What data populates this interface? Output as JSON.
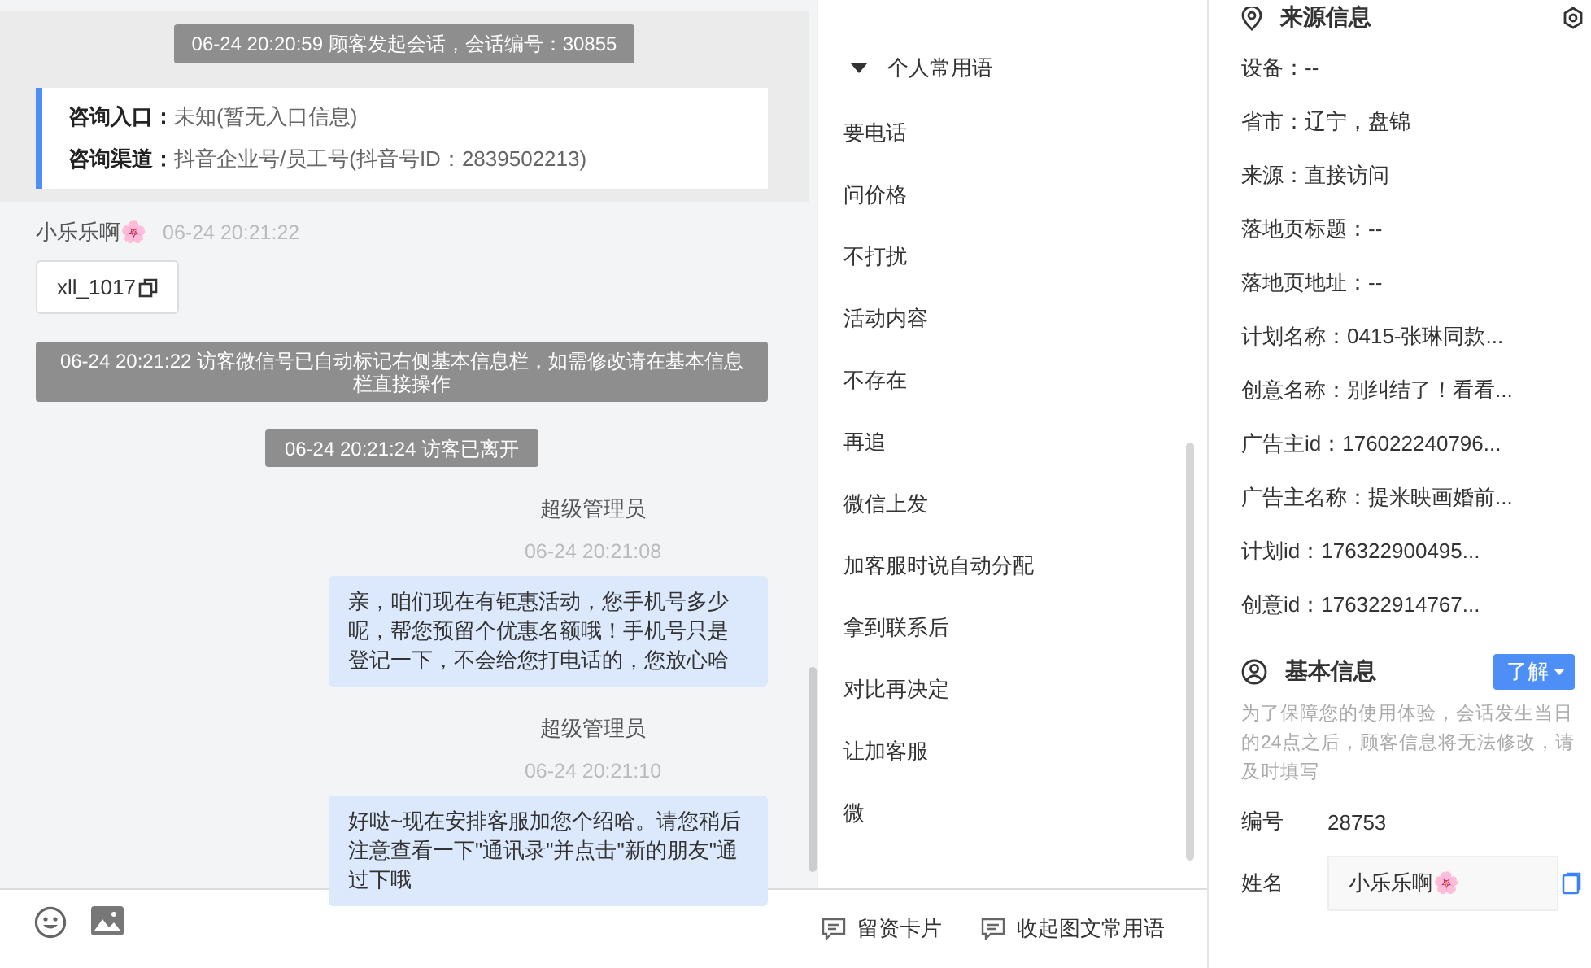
{
  "chat": {
    "session_notice": "06-24 20:20:59 顾客发起会话，会话编号：30855",
    "entry_lines": [
      {
        "label": "咨询入口：",
        "value": "未知(暂无入口信息)"
      },
      {
        "label": "咨询渠道：",
        "value": "抖音企业号/员工号(抖音号ID：2839502213)"
      }
    ],
    "messages": [
      {
        "kind": "visitor",
        "sender": "小乐乐啊🌸",
        "time": "06-24 20:21:22",
        "text": "xll_1017"
      },
      {
        "kind": "system",
        "text": "06-24 20:21:22 访客微信号已自动标记右侧基本信息栏，如需修改请在基本信息栏直接操作"
      },
      {
        "kind": "system",
        "text": "06-24 20:21:24 访客已离开"
      },
      {
        "kind": "agent",
        "sender": "超级管理员",
        "time": "06-24 20:21:08",
        "text": "亲，咱们现在有钜惠活动，您手机号多少呢，帮您预留个优惠名额哦！手机号只是登记一下，不会给您打电话的，您放心哈"
      },
      {
        "kind": "agent",
        "sender": "超级管理员",
        "time": "06-24 20:21:10",
        "text": "好哒~现在安排客服加您个绍哈。请您稍后注意查看一下\"通讯录\"并点击\"新的朋友\"通过下哦"
      }
    ]
  },
  "phrases": {
    "title": "个人常用语",
    "expanded": true,
    "items": [
      "要电话",
      "问价格",
      "不打扰",
      "活动内容",
      "不存在",
      "再追",
      "微信上发",
      "加客服时说自动分配",
      "拿到联系后",
      "对比再决定",
      "让加客服",
      "微"
    ]
  },
  "footer_actions": [
    "留资卡片",
    "收起图文常用语"
  ],
  "source": {
    "title": "来源信息",
    "fields": [
      "设备：--",
      "省市：辽宁，盘锦",
      "来源：直接访问",
      "落地页标题：--",
      "落地页地址：--",
      "计划名称：0415-张琳同款...",
      "创意名称：别纠结了！看看...",
      "广告主id：176022240796...",
      "广告主名称：提米映画婚前...",
      "计划id：176322900495...",
      "创意id：176322914767..."
    ]
  },
  "basic": {
    "title": "基本信息",
    "button": "了解",
    "note": "为了保障您的使用体验，会话发生当日的24点之后，顾客信息将无法修改，请及时填写",
    "id_label": "编号",
    "id": "28753",
    "name_label": "姓名",
    "name": "小乐乐啊🌸"
  }
}
